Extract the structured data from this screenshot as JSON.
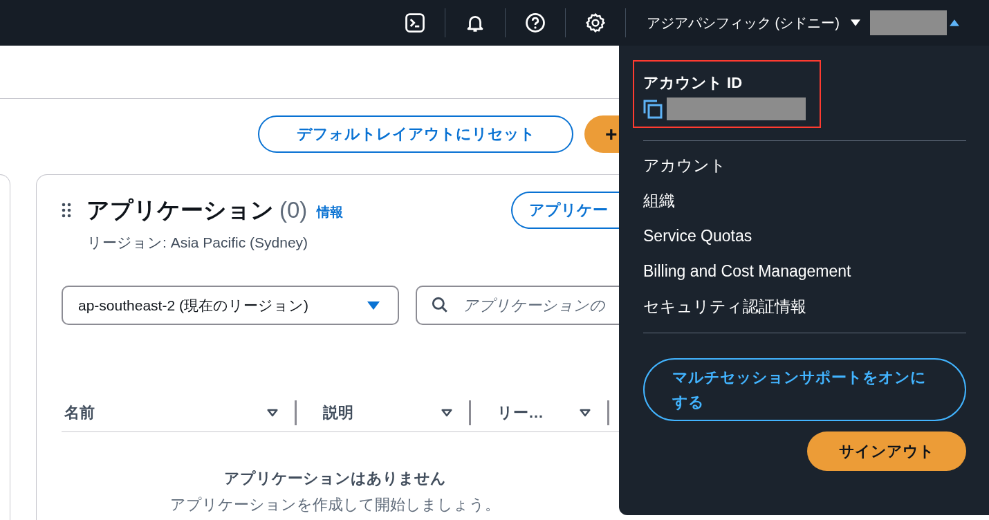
{
  "top_bar": {
    "region": "アジアパシフィック (シドニー)",
    "account_menu_expanded": true
  },
  "toolbar": {
    "reset_button": "デフォルトレイアウトにリセット",
    "add_button": "+"
  },
  "applications": {
    "title": "アプリケーション",
    "count": "(0)",
    "info_link": "情報",
    "create_button": "アプリケー",
    "region_note": "リージョン: Asia Pacific (Sydney)",
    "region_select": "ap-southeast-2 (現在のリージョン)",
    "search": {
      "placeholder": "アプリケーションの"
    },
    "columns": [
      {
        "label": "名前"
      },
      {
        "label": "説明"
      },
      {
        "label": "リー…"
      }
    ],
    "empty_title": "アプリケーションはありません",
    "empty_text": "アプリケーションを作成して開始しましょう。"
  },
  "account_menu": {
    "account_id_label": "アカウント ID",
    "items": [
      "アカウント",
      "組織",
      "Service Quotas",
      "Billing and Cost Management",
      "セキュリティ認証情報"
    ],
    "multi_session_button": "マルチセッションサポートをオンにする",
    "sign_out_button": "サインアウト"
  }
}
